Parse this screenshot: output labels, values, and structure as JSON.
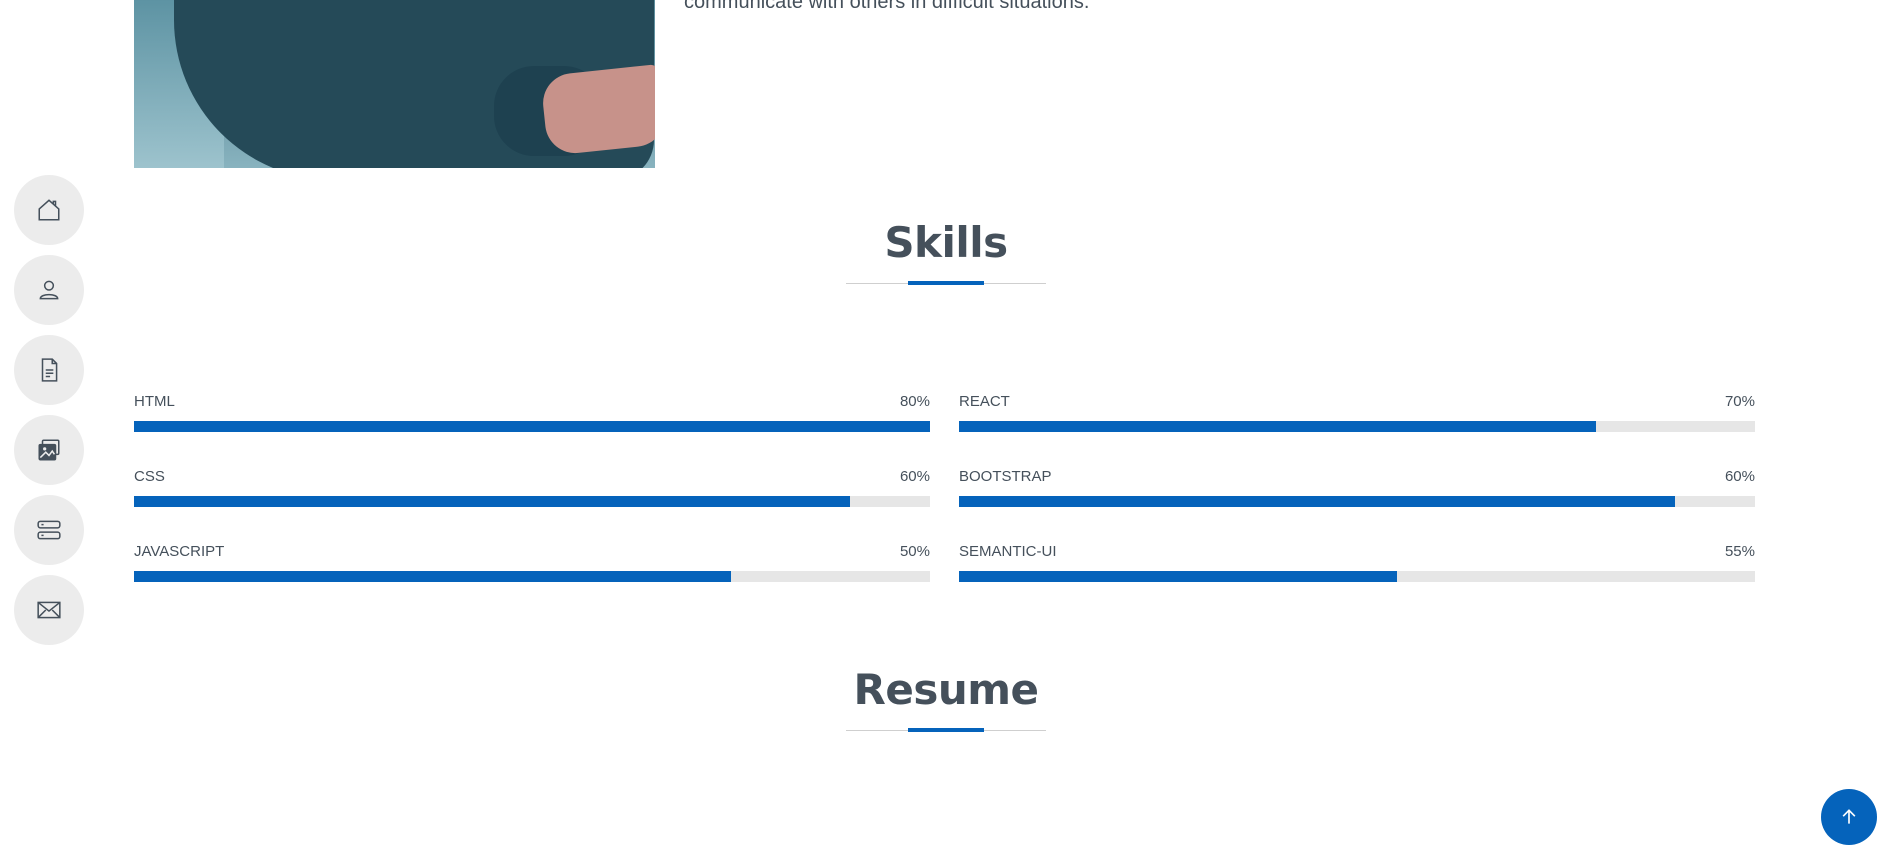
{
  "about": {
    "text": "communicate with others in difficult situations."
  },
  "nav": [
    {
      "name": "nav-home",
      "icon": "home-icon"
    },
    {
      "name": "nav-about",
      "icon": "person-icon"
    },
    {
      "name": "nav-resume",
      "icon": "file-icon"
    },
    {
      "name": "nav-portfolio",
      "icon": "images-icon"
    },
    {
      "name": "nav-services",
      "icon": "server-icon"
    },
    {
      "name": "nav-contact",
      "icon": "envelope-icon"
    }
  ],
  "skills_section": {
    "title": "Skills",
    "items": [
      {
        "label": "HTML",
        "percent_label": "80%",
        "fill_fraction": 1.0
      },
      {
        "label": "REACT",
        "percent_label": "70%",
        "fill_fraction": 0.8
      },
      {
        "label": "CSS",
        "percent_label": "60%",
        "fill_fraction": 0.9
      },
      {
        "label": "BOOTSTRAP",
        "percent_label": "60%",
        "fill_fraction": 0.9
      },
      {
        "label": "JAVASCRIPT",
        "percent_label": "50%",
        "fill_fraction": 0.75
      },
      {
        "label": "SEMANTIC-UI",
        "percent_label": "55%",
        "fill_fraction": 0.55
      }
    ]
  },
  "resume_section": {
    "title": "Resume"
  },
  "colors": {
    "accent": "#0563bb",
    "text": "#45505b",
    "track": "#e6e6e6",
    "nav_bg": "#ececec"
  },
  "back_to_top": {
    "icon": "arrow-up-icon"
  }
}
